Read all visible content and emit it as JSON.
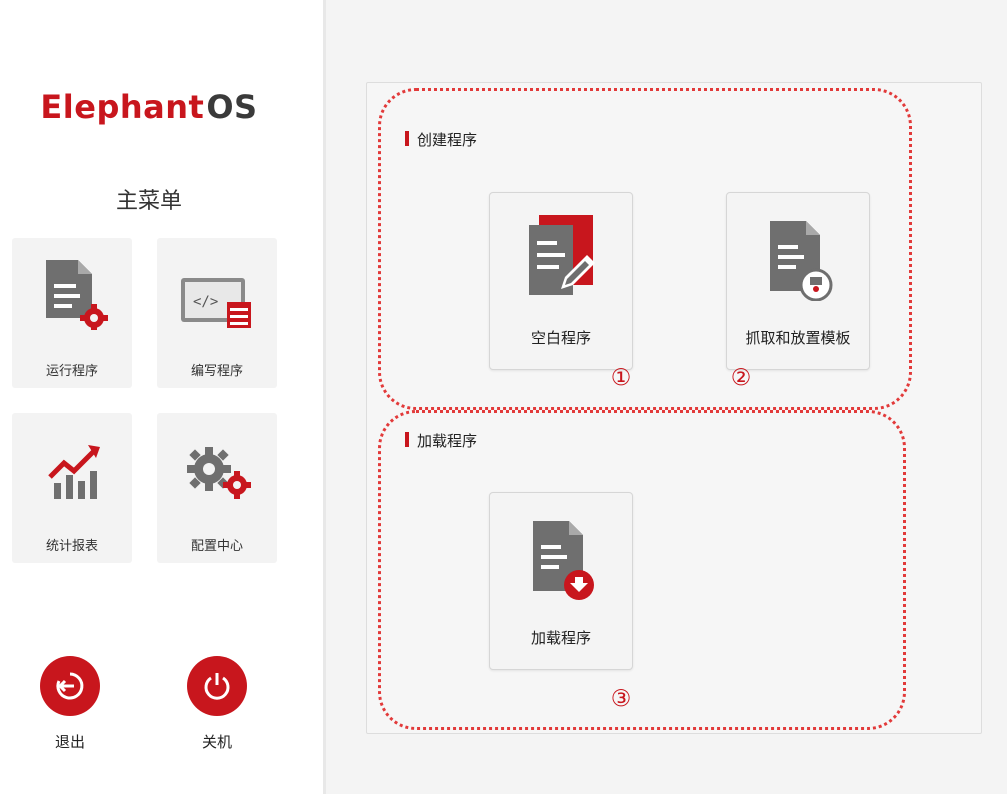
{
  "app": {
    "logo_part1": "Elephant",
    "logo_part2": "OS"
  },
  "sidebar": {
    "title": "主菜单",
    "tiles": [
      {
        "label": "运行程序",
        "icon": "run-program-icon"
      },
      {
        "label": "编写程序",
        "icon": "code-editor-icon"
      },
      {
        "label": "统计报表",
        "icon": "statistics-chart-icon"
      },
      {
        "label": "配置中心",
        "icon": "settings-gears-icon"
      }
    ],
    "exit_label": "退出",
    "shutdown_label": "关机"
  },
  "main": {
    "create_section": {
      "title": "创建程序",
      "cards": [
        {
          "label": "空白程序",
          "icon": "blank-program-icon",
          "marker": "①"
        },
        {
          "label": "抓取和放置模板",
          "icon": "pick-place-template-icon",
          "marker": "②"
        }
      ]
    },
    "load_section": {
      "title": "加载程序",
      "cards": [
        {
          "label": "加载程序",
          "icon": "load-program-icon",
          "marker": "③"
        }
      ]
    }
  },
  "colors": {
    "accent": "#c8161d",
    "icon_gray": "#6f6f6f",
    "annotation": "#e23a3a"
  }
}
